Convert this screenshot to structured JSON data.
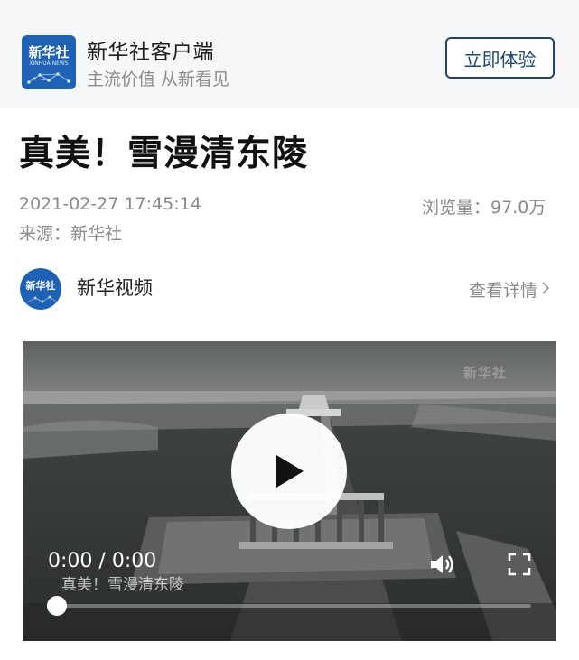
{
  "header": {
    "app_name": "新华社客户端",
    "slogan": "主流价值 从新看见",
    "try_button": "立即体验",
    "logo_text": "新华社",
    "logo_subtext": "XINHUA NEWS"
  },
  "article": {
    "title": "真美！雪漫清东陵",
    "datetime": "2021-02-27 17:45:14",
    "views_label": "浏览量：",
    "views_value": "97.0万",
    "source": "来源：新华社"
  },
  "author": {
    "name": "新华视频",
    "detail_link": "查看详情"
  },
  "video": {
    "current_time": "0:00",
    "separator": "/",
    "duration": "0:00",
    "caption": "真美！雪漫清东陵",
    "watermark": "新华社",
    "progress": 0
  },
  "colors": {
    "brand_blue": "#1e4575",
    "header_bg": "#f6f7f8",
    "meta_gray": "#8a8a8a"
  },
  "icons": [
    "play-icon",
    "volume-icon",
    "fullscreen-icon",
    "chevron-right-icon"
  ]
}
